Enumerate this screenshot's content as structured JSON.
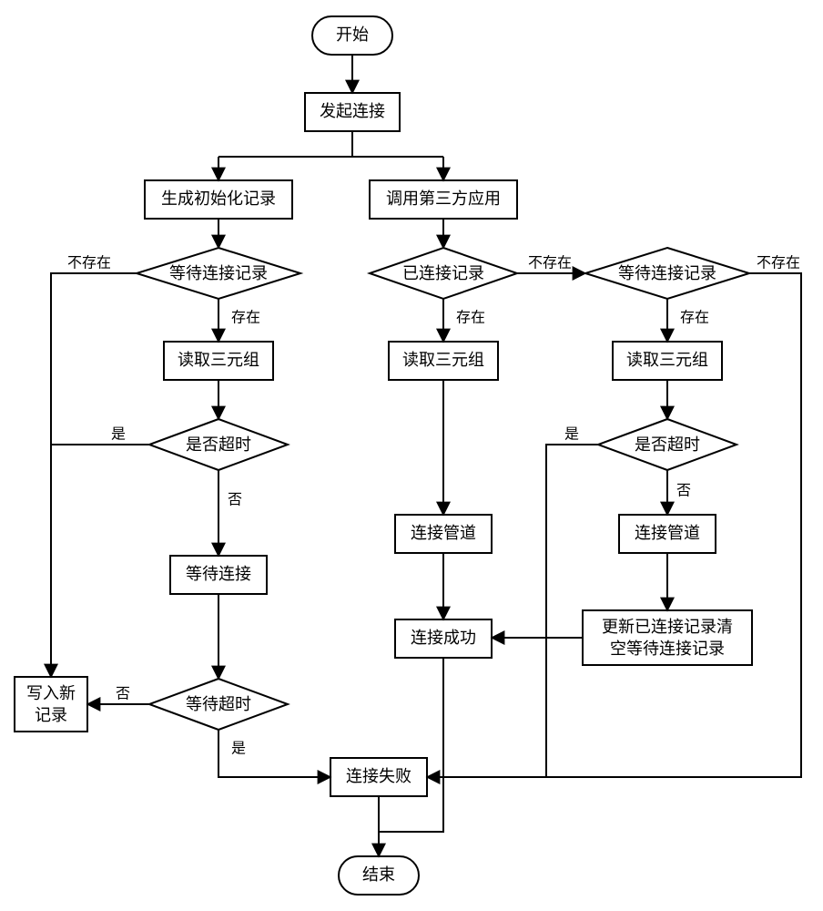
{
  "nodes": {
    "start": "开始",
    "initiate": "发起连接",
    "genInit": "生成初始化记录",
    "callThird": "调用第三方应用",
    "waitConnRecL": "等待连接记录",
    "connectedRec": "已连接记录",
    "waitConnRecR": "等待连接记录",
    "readTripleL": "读取三元组",
    "readTripleM": "读取三元组",
    "readTripleR": "读取三元组",
    "timeoutL": "是否超时",
    "timeoutR": "是否超时",
    "waitConn": "等待连接",
    "connPipeM": "连接管道",
    "connPipeR": "连接管道",
    "connSuccess": "连接成功",
    "updateClear_line1": "更新已连接记录清",
    "updateClear_line2": "空等待连接记录",
    "writeNew_line1": "写入新",
    "writeNew_line2": "记录",
    "waitTimeout": "等待超时",
    "connFail": "连接失败",
    "end": "结束"
  },
  "labels": {
    "notExist": "不存在",
    "exist": "存在",
    "yes": "是",
    "no": "否"
  }
}
